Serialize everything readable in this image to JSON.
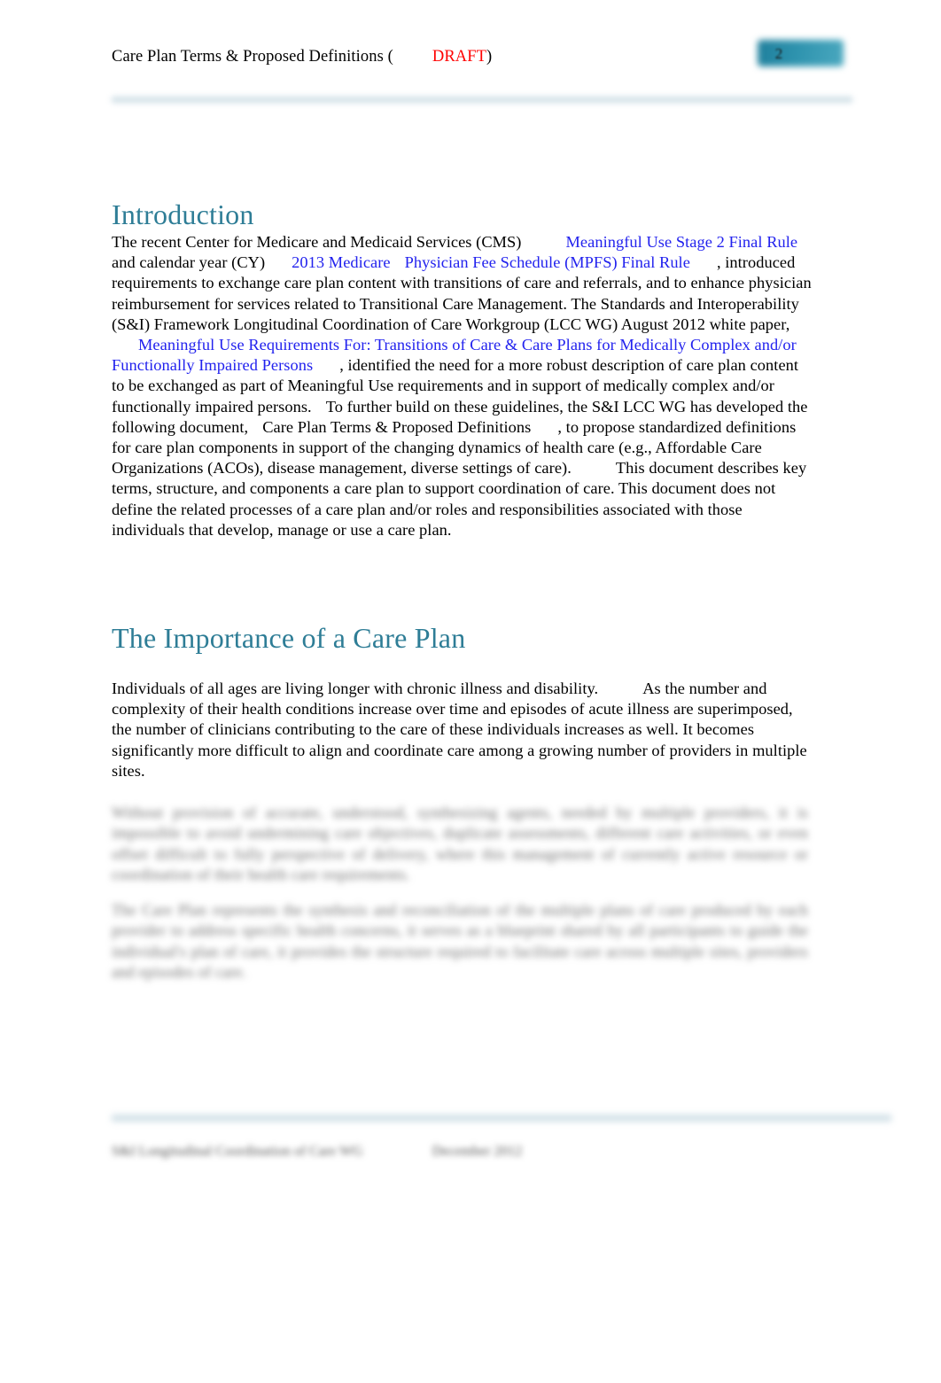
{
  "document": {
    "page_number": "2",
    "header": {
      "title_prefix": "Care Plan Terms & Proposed Definitions (",
      "draft_label": "DRAFT",
      "title_suffix": ")"
    },
    "accent_color": "#2e7d96",
    "link_color": "#2222ee",
    "draft_color": "#ff0000",
    "rule_color": "#cfdfe6"
  },
  "sections": {
    "introduction": {
      "heading": "Introduction",
      "paragraph": {
        "t1": "The recent Center for Medicare and Medicaid Services (CMS)",
        "link1": "Meaningful Use Stage 2 Final Rule",
        "t2": "and calendar year (CY)",
        "link2a": "2013 Medicare",
        "link2b": "Physician Fee Schedule (MPFS) Final Rule",
        "t3": ", introduced requirements to exchange care plan content with transitions of care and referrals, and to enhance physician reimbursement for services related to Transitional Care Management. The Standards and Interoperability (S&I) Framework Longitudinal Coordination of Care Workgroup (LCC WG) August 2012 white paper,",
        "link3": "Meaningful Use Requirements For: Transitions of Care & Care Plans for Medically Complex and/or Functionally Impaired Persons",
        "t4": ", identified the need for a more robust description of care plan content to be exchanged as part of Meaningful Use requirements and in support of medically complex and/or functionally impaired persons.",
        "t5": "To further build on these guidelines, the S&I LCC WG has developed the following document,",
        "doc_title": "Care Plan Terms & Proposed Definitions",
        "t6": ", to propose standardized definitions for care plan components in support of the changing dynamics of health care (e.g., Affordable Care Organizations (ACOs), disease management, diverse settings of care).",
        "t7": "This document describes key terms, structure, and components a care plan to support coordination of care. This document does not define the related processes of a care plan and/or roles and responsibilities associated with those individuals that develop, manage or use a care plan."
      }
    },
    "importance": {
      "heading": "The Importance of a Care Plan",
      "paragraph": {
        "t1": "Individuals of all ages are living longer with chronic illness and disability.",
        "t2": "As the number and complexity of their health conditions increase over time and episodes of acute illness are superimposed, the number of clinicians contributing to the care of these individuals increases as well.  It becomes significantly more difficult to align and coordinate care among a growing number of providers in multiple sites."
      },
      "redacted_paragraph_1": "Without provision of accurate, understood, synthesizing agents, needed by multiple providers, it is impossible to avoid undermining care objectives, duplicate assessments, different care activities, or even offset difficult to fully perspective of delivery, where this management of currently active resource or coordination of their health care requirements.",
      "redacted_paragraph_2": "The Care Plan represents the synthesis and reconciliation of the multiple plans of care produced by each provider to address specific health concerns, it serves as a blueprint shared by all participants to guide the individual's plan of care, it provides the structure required to facilitate care across multiple sites, providers and episodes of care."
    }
  },
  "footer": {
    "left": "S&I Longitudinal Coordination of Care WG",
    "right": "December 2012"
  }
}
